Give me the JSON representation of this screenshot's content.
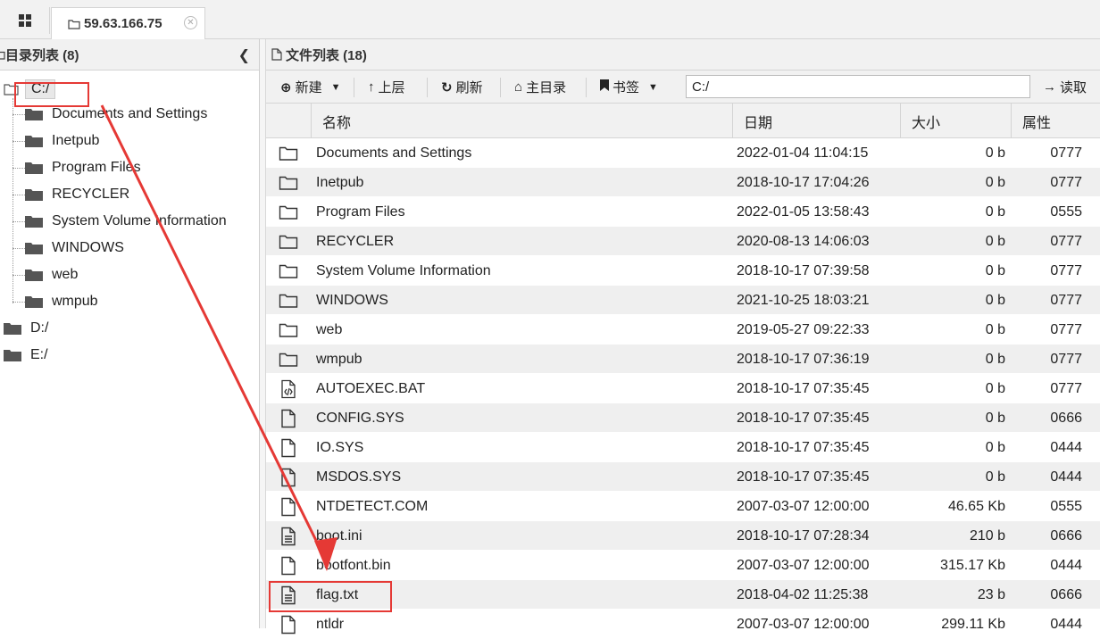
{
  "top_tab": {
    "title": "59.63.166.75"
  },
  "left_panel": {
    "title": "目录列表 (8)",
    "root": "C:/",
    "children": [
      "Documents and Settings",
      "Inetpub",
      "Program Files",
      "RECYCLER",
      "System Volume Information",
      "WINDOWS",
      "web",
      "wmpub"
    ],
    "drives": [
      "D:/",
      "E:/"
    ]
  },
  "right_panel": {
    "title": "文件列表 (18)",
    "toolbar": {
      "new": "新建",
      "up": "上层",
      "refresh": "刷新",
      "home": "主目录",
      "bookmark": "书签",
      "path": "C:/",
      "read": "读取"
    },
    "columns": {
      "name": "名称",
      "date": "日期",
      "size": "大小",
      "attr": "属性"
    },
    "files": [
      {
        "type": "folder",
        "name": "Documents and Settings",
        "date": "2022-01-04 11:04:15",
        "size": "0 b",
        "attr": "0777"
      },
      {
        "type": "folder",
        "name": "Inetpub",
        "date": "2018-10-17 17:04:26",
        "size": "0 b",
        "attr": "0777"
      },
      {
        "type": "folder",
        "name": "Program Files",
        "date": "2022-01-05 13:58:43",
        "size": "0 b",
        "attr": "0555"
      },
      {
        "type": "folder",
        "name": "RECYCLER",
        "date": "2020-08-13 14:06:03",
        "size": "0 b",
        "attr": "0777"
      },
      {
        "type": "folder",
        "name": "System Volume Information",
        "date": "2018-10-17 07:39:58",
        "size": "0 b",
        "attr": "0777"
      },
      {
        "type": "folder",
        "name": "WINDOWS",
        "date": "2021-10-25 18:03:21",
        "size": "0 b",
        "attr": "0777"
      },
      {
        "type": "folder",
        "name": "web",
        "date": "2019-05-27 09:22:33",
        "size": "0 b",
        "attr": "0777"
      },
      {
        "type": "folder",
        "name": "wmpub",
        "date": "2018-10-17 07:36:19",
        "size": "0 b",
        "attr": "0777"
      },
      {
        "type": "code",
        "name": "AUTOEXEC.BAT",
        "date": "2018-10-17 07:35:45",
        "size": "0 b",
        "attr": "0777"
      },
      {
        "type": "file",
        "name": "CONFIG.SYS",
        "date": "2018-10-17 07:35:45",
        "size": "0 b",
        "attr": "0666"
      },
      {
        "type": "file",
        "name": "IO.SYS",
        "date": "2018-10-17 07:35:45",
        "size": "0 b",
        "attr": "0444"
      },
      {
        "type": "file",
        "name": "MSDOS.SYS",
        "date": "2018-10-17 07:35:45",
        "size": "0 b",
        "attr": "0444"
      },
      {
        "type": "file",
        "name": "NTDETECT.COM",
        "date": "2007-03-07 12:00:00",
        "size": "46.65 Kb",
        "attr": "0555"
      },
      {
        "type": "text",
        "name": "boot.ini",
        "date": "2018-10-17 07:28:34",
        "size": "210 b",
        "attr": "0666"
      },
      {
        "type": "file",
        "name": "bootfont.bin",
        "date": "2007-03-07 12:00:00",
        "size": "315.17 Kb",
        "attr": "0444"
      },
      {
        "type": "text",
        "name": "flag.txt",
        "date": "2018-04-02 11:25:38",
        "size": "23 b",
        "attr": "0666"
      },
      {
        "type": "file",
        "name": "ntldr",
        "date": "2007-03-07 12:00:00",
        "size": "299.11 Kb",
        "attr": "0444"
      }
    ]
  },
  "annotation_color": "#e53935"
}
